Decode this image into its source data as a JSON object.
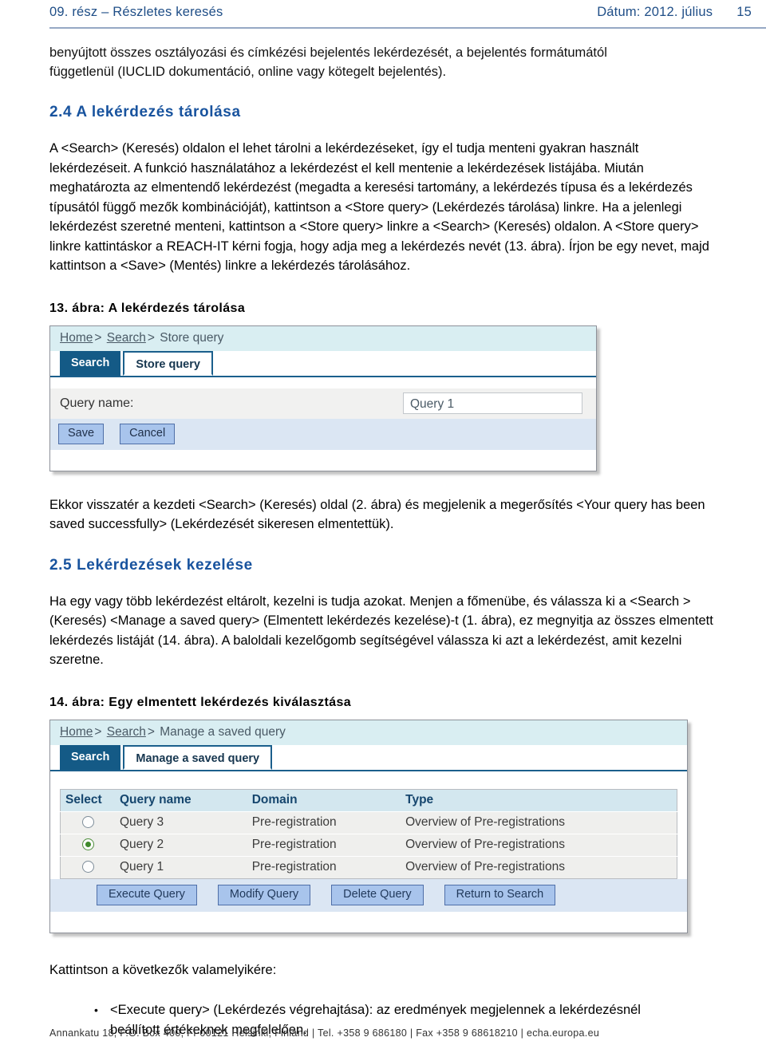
{
  "header": {
    "title": "09. rész – Részletes keresés",
    "date_label": "Dátum: 2012. július",
    "page_number": "15"
  },
  "intro_paragraph": "benyújtott összes osztályozási és címkézési bejelentés lekérdezését, a bejelentés formátumától függetlenül (IUCLID dokumentáció, online vagy kötegelt bejelentés).",
  "sections": {
    "s24": {
      "heading": "2.4 A lekérdezés tárolása",
      "paragraph": "A <Search> (Keresés) oldalon el lehet tárolni a lekérdezéseket, így el tudja menteni gyakran használt lekérdezéseit. A funkció használatához a lekérdezést el kell mentenie a lekérdezések listájába. Miután meghatározta az elmentendő lekérdezést (megadta a keresési tartomány, a lekérdezés típusa és a lekérdezés típusától függő mezők kombinációját), kattintson a <Store query> (Lekérdezés tárolása) linkre. Ha a jelenlegi lekérdezést szeretné menteni, kattintson a <Store query> linkre a <Search> (Keresés) oldalon. A <Store query> linkre kattintáskor a REACH-IT kérni fogja, hogy adja meg a lekérdezés nevét (13. ábra). Írjon be egy nevet, majd kattintson a <Save> (Mentés) linkre a lekérdezés tárolásához.",
      "after_figure_paragraph": "Ekkor visszatér a kezdeti <Search> (Keresés) oldal (2. ábra) és megjelenik a megerősítés <Your query has been saved successfully> (Lekérdezését sikeresen elmentettük)."
    },
    "s25": {
      "heading": "2.5 Lekérdezések kezelése",
      "paragraph": "Ha egy vagy több lekérdezést eltárolt, kezelni is tudja azokat. Menjen a főmenübe, és válassza ki a <Search > (Keresés) <Manage a saved query> (Elmentett lekérdezés kezelése)-t (1. ábra), ez megnyitja az összes elmentett lekérdezés listáját (14. ábra). A baloldali kezelőgomb segítségével válassza ki azt a lekérdezést, amit kezelni szeretne.",
      "click_intro": "Kattintson a következők valamelyikére:",
      "bullets": [
        "<Execute query> (Lekérdezés végrehajtása): az eredmények megjelennek a lekérdezésnél beállított értékeknek megfelelően."
      ]
    }
  },
  "figure13": {
    "caption": "13. ábra: A lekérdezés tárolása",
    "breadcrumb": {
      "home": "Home",
      "sep1": ">",
      "search": "Search",
      "sep2": ">",
      "current": "Store query"
    },
    "tabs": [
      {
        "label": "Search",
        "state": "dark"
      },
      {
        "label": "Store query",
        "state": "front"
      }
    ],
    "form": {
      "query_name_label": "Query name:",
      "query_name_value": "Query 1"
    },
    "buttons": [
      {
        "label": "Save"
      },
      {
        "label": "Cancel"
      }
    ]
  },
  "figure14": {
    "caption": "14. ábra: Egy elmentett lekérdezés kiválasztása",
    "breadcrumb": {
      "home": "Home",
      "sep1": ">",
      "search": "Search",
      "sep2": ">",
      "current": "Manage a saved query"
    },
    "tabs": [
      {
        "label": "Search",
        "state": "dark"
      },
      {
        "label": "Manage a saved query",
        "state": "front"
      }
    ],
    "table": {
      "columns": [
        "Select",
        "Query name",
        "Domain",
        "Type"
      ],
      "rows": [
        {
          "selected": false,
          "name": "Query 3",
          "domain": "Pre-registration",
          "type": "Overview of Pre-registrations"
        },
        {
          "selected": true,
          "name": "Query 2",
          "domain": "Pre-registration",
          "type": "Overview of Pre-registrations"
        },
        {
          "selected": false,
          "name": "Query 1",
          "domain": "Pre-registration",
          "type": "Overview of Pre-registrations"
        }
      ]
    },
    "buttons": [
      {
        "label": "Execute Query"
      },
      {
        "label": "Modify Query"
      },
      {
        "label": "Delete Query"
      },
      {
        "label": "Return to Search"
      }
    ]
  },
  "footer": {
    "text": "Annankatu 18, P.O. Box 400, FI-00121 Helsinki, Finland | Tel. +358 9 686180 | Fax +358 9 68618210 | echa.europa.eu"
  },
  "colors": {
    "heading_blue": "#18539e",
    "header_blue": "#1f4e87",
    "tab_dark": "#145a86",
    "breadcrumb_bg": "#d9eef2",
    "button_blue": "#a8c4ec",
    "table_header_bg": "#d3e7ef",
    "radio_green": "#3f8a2b"
  }
}
